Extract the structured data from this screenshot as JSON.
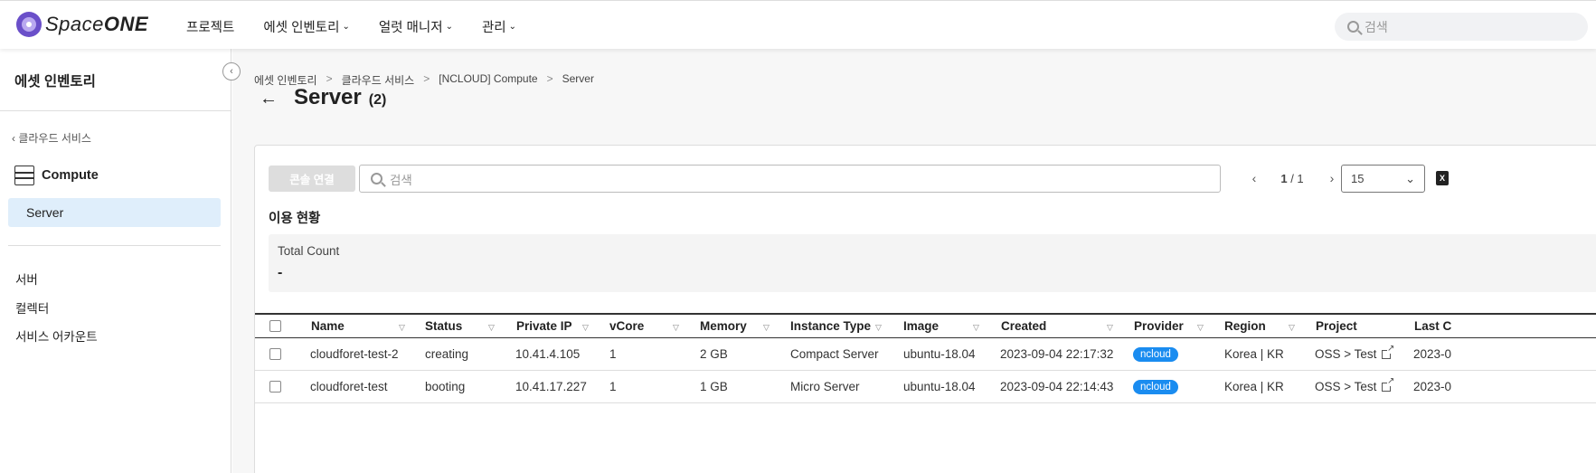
{
  "brand": {
    "name_light": "Space",
    "name_bold": "ONE"
  },
  "nav": {
    "items": [
      {
        "label": "프로젝트",
        "dropdown": false
      },
      {
        "label": "에셋 인벤토리",
        "dropdown": true
      },
      {
        "label": "얼럿 매니저",
        "dropdown": true
      },
      {
        "label": "관리",
        "dropdown": true
      }
    ],
    "search_placeholder": "검색"
  },
  "sidebar": {
    "title": "에셋 인벤토리",
    "back_label": "클라우드 서비스",
    "category": "Compute",
    "active_item": "Server",
    "links": [
      "서버",
      "컬렉터",
      "서비스 어카운트"
    ]
  },
  "breadcrumb": [
    "에셋 인벤토리",
    "클라우드 서비스",
    "[NCLOUD] Compute",
    "Server"
  ],
  "page": {
    "title": "Server",
    "count": "(2)"
  },
  "toolbar": {
    "console_button": "콘솔 연결",
    "search_placeholder": "검색",
    "page_current": "1",
    "page_total": "/ 1",
    "page_size": "15",
    "excel_label": "X"
  },
  "usage": {
    "title": "이용 현황",
    "label": "Total Count",
    "value": "-"
  },
  "table": {
    "columns": [
      "Name",
      "Status",
      "Private IP",
      "vCore",
      "Memory",
      "Instance Type",
      "Image",
      "Created",
      "Provider",
      "Region",
      "Project",
      "Last C"
    ],
    "rows": [
      {
        "name": "cloudforet-test-2",
        "status": "creating",
        "ip": "10.41.4.105",
        "vcore": "1",
        "memory": "2 GB",
        "instance_type": "Compact Server",
        "image": "ubuntu-18.04",
        "created": "2023-09-04 22:17:32",
        "provider": "ncloud",
        "region": "Korea | KR",
        "project": "OSS > Test",
        "last": "2023-0"
      },
      {
        "name": "cloudforet-test",
        "status": "booting",
        "ip": "10.41.17.227",
        "vcore": "1",
        "memory": "1 GB",
        "instance_type": "Micro Server",
        "image": "ubuntu-18.04",
        "created": "2023-09-04 22:14:43",
        "provider": "ncloud",
        "region": "Korea | KR",
        "project": "OSS > Test",
        "last": "2023-0"
      }
    ]
  },
  "colors": {
    "accent": "#1a8cf0",
    "active_bg": "#dfeefb",
    "brand": "#6a4fc9"
  }
}
